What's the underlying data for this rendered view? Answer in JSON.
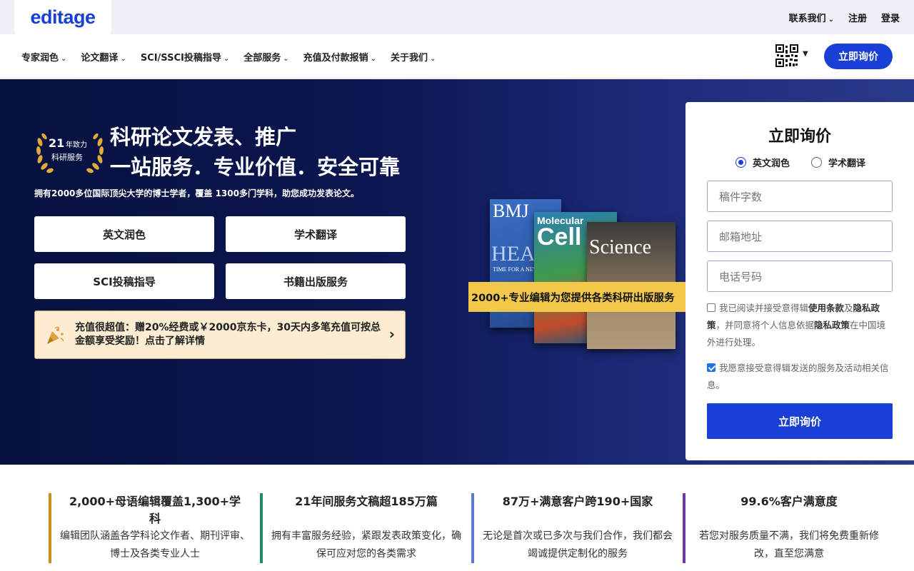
{
  "brand": {
    "logo": "editage",
    "accent": "#1a3fd6"
  },
  "topbar": {
    "contact": "联系我们",
    "register": "注册",
    "login": "登录"
  },
  "nav": {
    "items": [
      "专家润色",
      "论文翻译",
      "SCI/SSCI投稿指导",
      "全部服务",
      "充值及付款报销",
      "关于我们"
    ],
    "cta": "立即询价",
    "qr_icon": "qr-code-icon"
  },
  "hero": {
    "badge": {
      "number": "21",
      "line1": "年致力",
      "line2": "科研服务"
    },
    "title_line1": "科研论文发表、推广",
    "title_line2": "一站服务．专业价值．安全可靠",
    "subtitle": "拥有2000多位国际顶尖大学的博士学者，覆盖 1300多门学科，助您成功发表论文。",
    "buttons": [
      "英文润色",
      "学术翻译",
      "SCI投稿指导",
      "书籍出版服务"
    ],
    "promo": "充值很超值：赠20%经费或￥2000京东卡，30天内多笔充值可按总金额享受奖励！点击了解详情",
    "journals": {
      "bmj": "BMJ",
      "cell_top": "Molecular",
      "cell": "Cell",
      "science": "Science",
      "bmj_sub": "HEA",
      "bmj_small": "TIME FOR A NEW"
    },
    "ribbon": "2000+专业编辑为您提供各类科研出版服务"
  },
  "form": {
    "title": "立即询价",
    "radio_options": [
      "英文润色",
      "学术翻译"
    ],
    "selected": "英文润色",
    "placeholders": {
      "words": "稿件字数",
      "email": "邮箱地址",
      "phone": "电话号码"
    },
    "consent1": {
      "prefix": "我已阅读并接受意得辑",
      "terms": "使用条款",
      "and": "及",
      "privacy": "隐私政策",
      "middle": "，并同意将个人信息依据",
      "privacy2": "隐私政策",
      "suffix": "在中国境外进行处理。",
      "checked": false
    },
    "consent2": {
      "text": "我愿意接受意得辑发送的服务及活动相关信息。",
      "checked": true
    },
    "submit": "立即询价"
  },
  "stats": [
    {
      "title": "2,000+母语编辑覆盖1,300+学科",
      "desc": "编辑团队涵盖各学科论文作者、期刊评审、博士及各类专业人士",
      "color": "#c98d1a"
    },
    {
      "title": "21年间服务文稿超185万篇",
      "desc": "拥有丰富服务经验，紧跟发表政策变化，确保可应对您的各类需求",
      "color": "#1f8a6a"
    },
    {
      "title": "87万+满意客户跨190+国家",
      "desc": "无论是首次或已多次与我们合作，我们都会竭诚提供定制化的服务",
      "color": "#5a7bd0"
    },
    {
      "title": "99.6%客户满意度",
      "desc": "若您对服务质量不满，我们将免费重新修改，直至您满意",
      "color": "#6a3aa0"
    }
  ]
}
